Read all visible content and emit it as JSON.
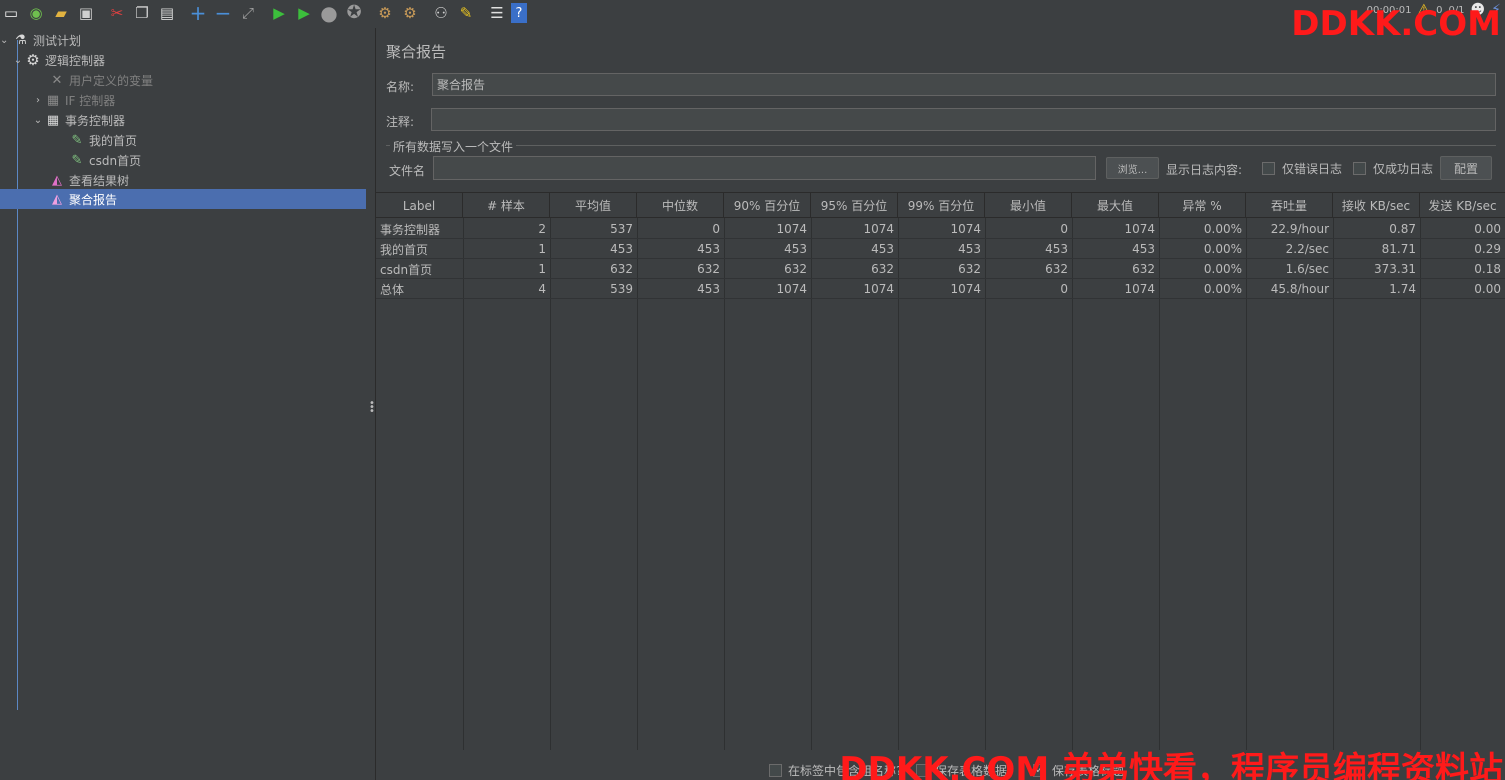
{
  "toolbar": {
    "icons": [
      "new-icon",
      "templates-icon",
      "open-icon",
      "save-icon",
      "cut-icon",
      "copy-icon",
      "paste-icon",
      "expand-icon",
      "collapse-icon",
      "toggle-icon",
      "start-icon",
      "start-no-pause-icon",
      "stop-icon",
      "shutdown-icon",
      "clear-icon",
      "clear-all-icon",
      "search-icon",
      "reset-search-icon",
      "function-helper-icon",
      "help-icon"
    ],
    "timer": "00:00:01",
    "warning_count": "0",
    "threads": "0/1"
  },
  "watermark": {
    "top": "DDKK.COM",
    "bottom": "DDKK.COM 弟弟快看，程序员编程资料站"
  },
  "tree": {
    "items": [
      {
        "label": "测试计划"
      },
      {
        "label": "逻辑控制器"
      },
      {
        "label": "用户定义的变量"
      },
      {
        "label": "IF 控制器"
      },
      {
        "label": "事务控制器"
      },
      {
        "label": "我的首页"
      },
      {
        "label": "csdn首页"
      },
      {
        "label": "查看结果树"
      },
      {
        "label": "聚合报告"
      }
    ]
  },
  "panel": {
    "title": "聚合报告",
    "name_label": "名称:",
    "name_value": "聚合报告",
    "comment_label": "注释:",
    "comment_value": "",
    "file_group_title": "所有数据写入一个文件",
    "filename_label": "文件名",
    "filename_value": "",
    "browse_button": "浏览...",
    "log_display_label": "显示日志内容:",
    "errors_only_label": "仅错误日志",
    "success_only_label": "仅成功日志",
    "configure_button": "配置"
  },
  "table": {
    "headers": [
      "Label",
      "# 样本",
      "平均值",
      "中位数",
      "90% 百分位",
      "95% 百分位",
      "99% 百分位",
      "最小值",
      "最大值",
      "异常 %",
      "吞吐量",
      "接收 KB/sec",
      "发送 KB/sec"
    ],
    "rows": [
      [
        "事务控制器",
        "2",
        "537",
        "0",
        "1074",
        "1074",
        "1074",
        "0",
        "1074",
        "0.00%",
        "22.9/hour",
        "0.87",
        "0.00"
      ],
      [
        "我的首页",
        "1",
        "453",
        "453",
        "453",
        "453",
        "453",
        "453",
        "453",
        "0.00%",
        "2.2/sec",
        "81.71",
        "0.29"
      ],
      [
        "csdn首页",
        "1",
        "632",
        "632",
        "632",
        "632",
        "632",
        "632",
        "632",
        "0.00%",
        "1.6/sec",
        "373.31",
        "0.18"
      ],
      [
        "总体",
        "4",
        "539",
        "453",
        "1074",
        "1074",
        "1074",
        "0",
        "1074",
        "0.00%",
        "45.8/hour",
        "1.74",
        "0.00"
      ]
    ]
  },
  "bottom": {
    "use_group_name_label": "在标签中包含组名称?",
    "save_table_label": "保存表格数据",
    "save_table_header_label": "保存表格标题"
  }
}
